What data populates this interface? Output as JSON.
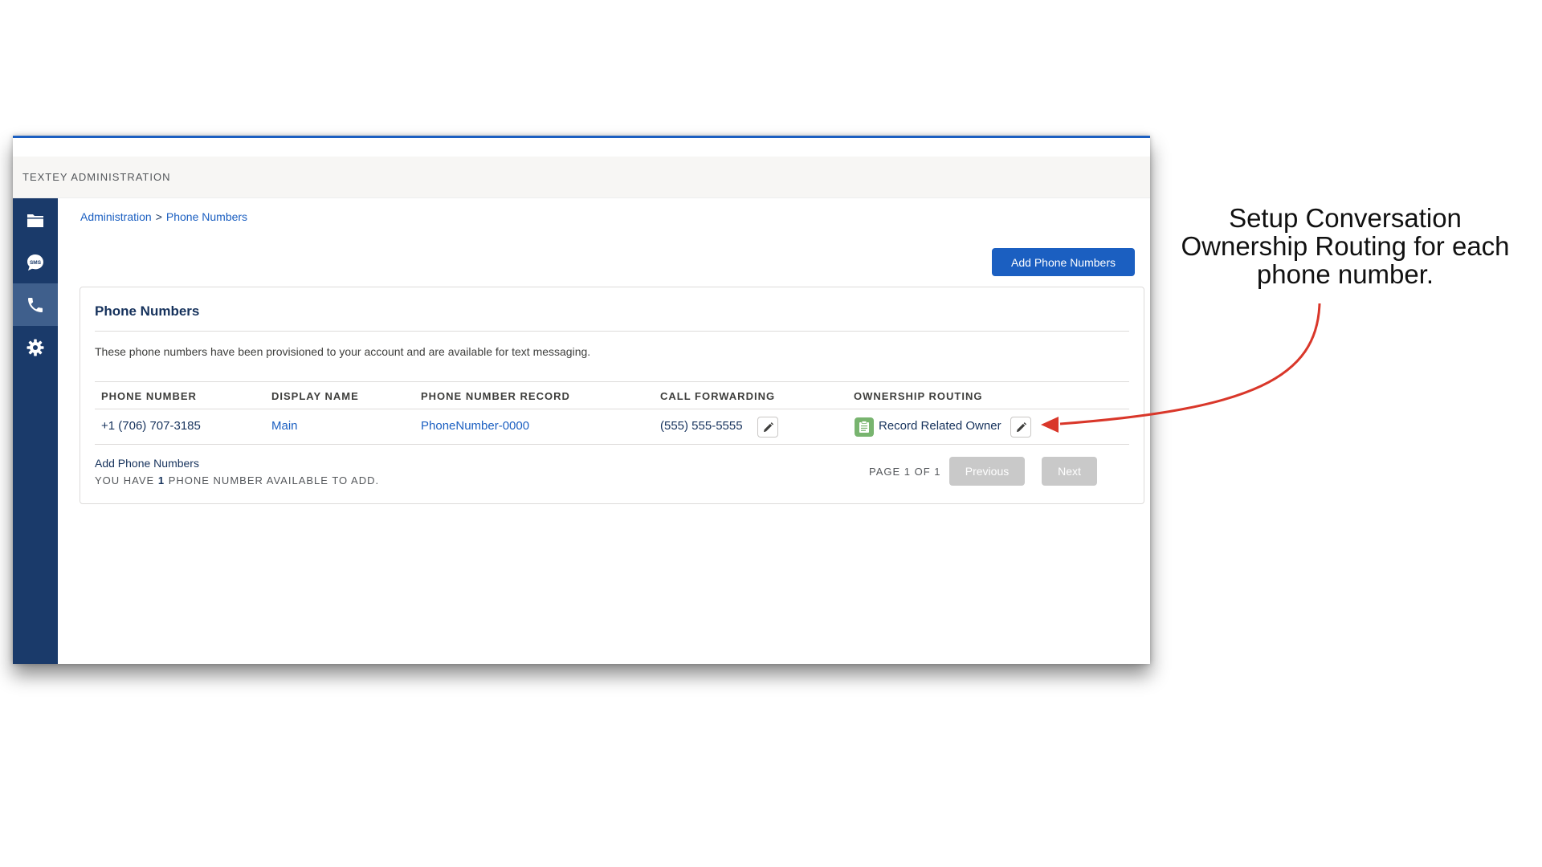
{
  "app": {
    "title": "TEXTEY ADMINISTRATION"
  },
  "sidebar": {
    "items": [
      {
        "icon": "folder-icon",
        "active": false
      },
      {
        "icon": "sms-icon",
        "label": "SMS",
        "active": false
      },
      {
        "icon": "phone-icon",
        "active": true
      },
      {
        "icon": "gear-icon",
        "active": false
      }
    ]
  },
  "breadcrumb": {
    "root": "Administration",
    "separator": ">",
    "current": "Phone Numbers"
  },
  "header": {
    "add_button": "Add Phone Numbers"
  },
  "card": {
    "title": "Phone Numbers",
    "description": "These phone numbers have been provisioned to your account and are available for text messaging.",
    "columns": [
      "PHONE NUMBER",
      "DISPLAY NAME",
      "PHONE NUMBER RECORD",
      "CALL FORWARDING",
      "OWNERSHIP ROUTING"
    ],
    "rows": [
      {
        "phone_number": "+1 (706) 707-3185",
        "display_name": "Main",
        "record": "PhoneNumber-0000",
        "call_forwarding": "(555) 555-5555",
        "ownership_routing": "Record Related Owner"
      }
    ],
    "footer": {
      "add_link": "Add Phone Numbers",
      "note_prefix": "YOU HAVE",
      "note_count": "1",
      "note_suffix": "PHONE NUMBER AVAILABLE TO ADD."
    },
    "pagination": {
      "label": "PAGE 1 OF 1",
      "previous": "Previous",
      "next": "Next"
    }
  },
  "annotation": {
    "line1": "Setup Conversation",
    "line2": "Ownership Routing for each",
    "line3": "phone number."
  },
  "colors": {
    "sidebar": "#1a3a6a",
    "sidebar_active": "#3f5f8c",
    "brand_blue": "#1b5fc1",
    "routing_badge": "#78b46f",
    "annotation_arrow": "#d9372a"
  }
}
